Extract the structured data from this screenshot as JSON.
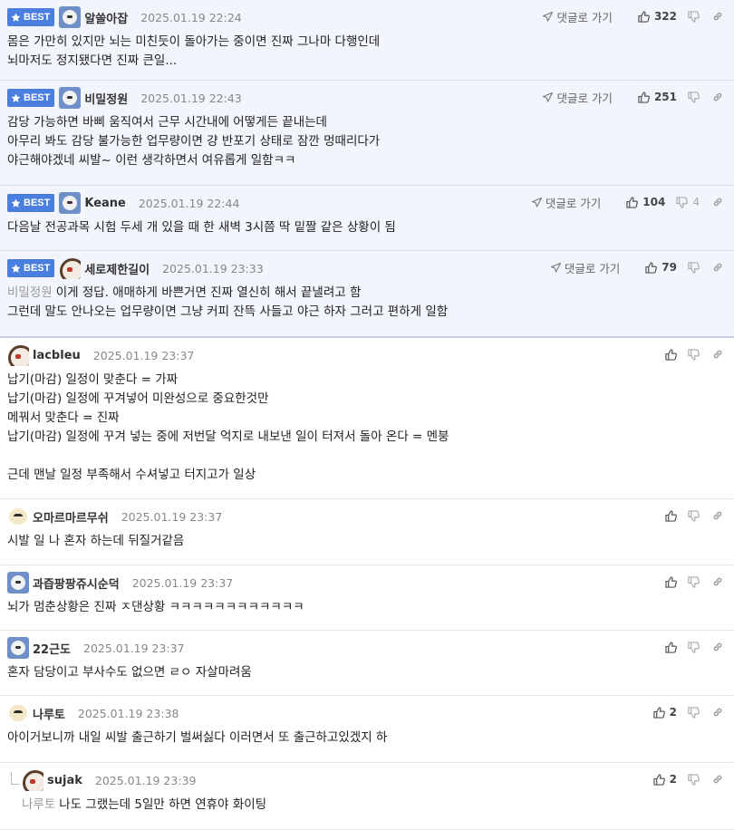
{
  "best_label": "BEST",
  "goto_label": "댓글로 가기",
  "comments": [
    {
      "best": true,
      "avatar": "type-a",
      "nick": "알쓸아잡",
      "date": "2025.01.19 22:24",
      "up": "322",
      "down": "",
      "lines": [
        "몸은 가만히 있지만 뇌는 미친듯이 돌아가는 중이면 진짜 그나마 다행인데",
        "뇌마저도 정지됐다면 진짜 큰일..."
      ]
    },
    {
      "best": true,
      "avatar": "type-a",
      "nick": "비밀정원",
      "date": "2025.01.19 22:43",
      "up": "251",
      "down": "",
      "lines": [
        "감당 가능하면 바삐 움직여서 근무 시간내에 어떻게든 끝내는데",
        "아무리 봐도 감당 불가능한 업무량이면 걍 반포기 상태로 잠깐 멍때리다가",
        "야근해야겠네 씨발~ 이런 생각하면서 여유롭게 일함ㅋㅋ"
      ]
    },
    {
      "best": true,
      "avatar": "type-a",
      "nick": "Keane",
      "date": "2025.01.19 22:44",
      "up": "104",
      "down": "4",
      "lines": [
        "다음날 전공과목 시험 두세 개 있을 때 한 새벽 3시쯤 딱 밑짤 같은 상황이 됨"
      ]
    },
    {
      "best": true,
      "avatar": "type-b",
      "nick": "세로제한길이",
      "date": "2025.01.19 23:33",
      "up": "79",
      "down": "",
      "mention": "비밀정원",
      "lines": [
        "이게 정답. 애매하게 바쁜거면 진짜 열신히 해서 끝낼려고 함",
        "그런데 말도 안나오는 업무량이면 그냥 커피 잔뜩 사들고 야근 하자 그러고 편하게 일함"
      ]
    },
    {
      "best": false,
      "avatar": "type-b",
      "nick": "lacbleu",
      "date": "2025.01.19 23:37",
      "up": "",
      "down": "",
      "lines": [
        "납기(마감) 일정이 맞춘다 = 가짜",
        "납기(마감) 일정에 꾸겨넣어 미완성으로 중요한것만",
        "메꿔서 맞춘다 = 진짜",
        "납기(마감) 일정에 꾸겨 넣는 중에 저번달 억지로 내보낸 일이 터져서 돌아 온다 = 멘붕",
        "",
        "근데 맨날 일정 부족해서 수셔넣고 터지고가 일상"
      ]
    },
    {
      "best": false,
      "avatar": "type-c",
      "nick": "오마르마르무쉬",
      "date": "2025.01.19 23:37",
      "up": "",
      "down": "",
      "lines": [
        "시발 일 나 혼자 하는데 뒤질거같음"
      ]
    },
    {
      "best": false,
      "avatar": "type-a",
      "nick": "과즙팡팡쥬시순덕",
      "date": "2025.01.19 23:37",
      "up": "",
      "down": "",
      "lines": [
        "뇌가 멈춘상황은 진짜 ㅈ댄상황 ㅋㅋㅋㅋㅋㅋㅋㅋㅋㅋㅋㅋ"
      ]
    },
    {
      "best": false,
      "avatar": "type-a",
      "nick": "22근도",
      "date": "2025.01.19 23:37",
      "up": "",
      "down": "",
      "lines": [
        "혼자 담당이고 부사수도 없으면 ㄹㅇ 자살마려움"
      ]
    },
    {
      "best": false,
      "avatar": "type-c",
      "nick": "나루토",
      "date": "2025.01.19 23:38",
      "up": "2",
      "down": "",
      "lines": [
        "아이거보니까 내일 씨발 출근하기 벌써싫다 이러면서 또 출근하고있겠지 하"
      ]
    },
    {
      "best": false,
      "reply": true,
      "avatar": "type-b",
      "nick": "sujak",
      "date": "2025.01.19 23:39",
      "up": "2",
      "down": "",
      "mention": "나루토",
      "lines": [
        "나도 그랬는데 5일만 하면 연휴야 화이팅"
      ]
    }
  ]
}
